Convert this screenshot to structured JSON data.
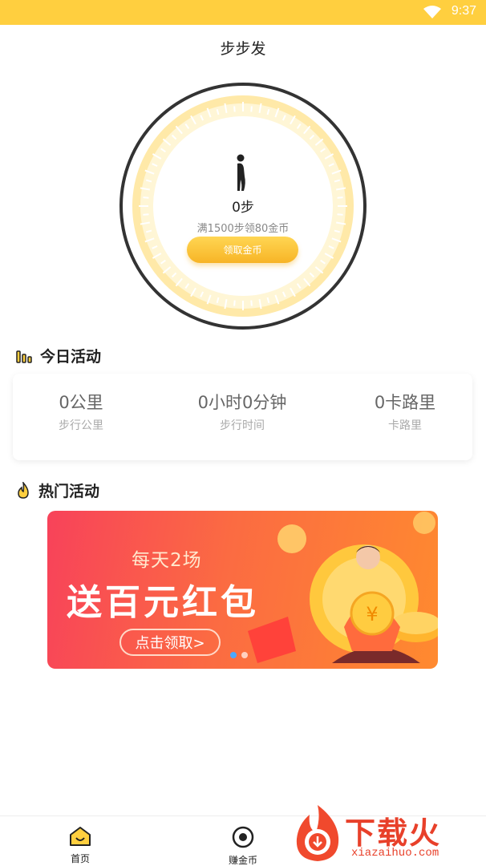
{
  "status_bar": {
    "time": "9:37"
  },
  "header": {
    "title": "步步发"
  },
  "dial": {
    "steps": "0步",
    "goal_text": "满1500步领80金币",
    "claim_label": "领取金币"
  },
  "today": {
    "section_title": "今日活动",
    "stats": [
      {
        "value": "0公里",
        "label": "步行公里"
      },
      {
        "value": "0小时0分钟",
        "label": "步行时间"
      },
      {
        "value": "0卡路里",
        "label": "卡路里"
      }
    ]
  },
  "hot": {
    "section_title": "热门活动",
    "banner": {
      "line1": "每天2场",
      "line2": "送百元红包",
      "cta": "点击领取>",
      "active_slide": 1,
      "slide_count": 2
    }
  },
  "tabbar": {
    "tabs": [
      {
        "label": "首页",
        "icon": "home-icon"
      },
      {
        "label": "赚金币",
        "icon": "coin-target-icon"
      }
    ]
  },
  "watermark": {
    "brand": "下载火",
    "url": "xiazaihuo.com"
  },
  "colors": {
    "accent": "#ffcf3f",
    "button": "#f7b426",
    "banner_start": "#f8425a",
    "banner_end": "#ff8a2f"
  }
}
